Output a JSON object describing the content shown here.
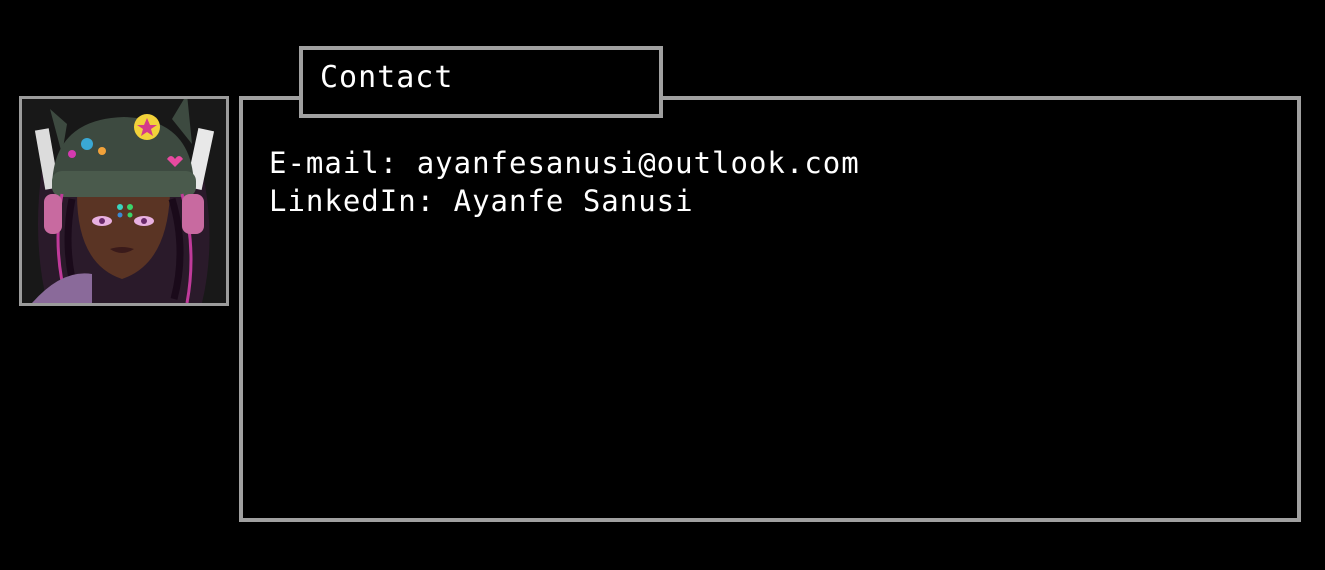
{
  "dialog": {
    "title": "Contact",
    "lines": [
      {
        "label": "E-mail:",
        "value": "ayanfesanusi@outlook.com"
      },
      {
        "label": "LinkedIn:",
        "value": "Ayanfe Sanusi"
      }
    ]
  },
  "portrait": {
    "icon": "character-portrait-icon"
  },
  "colors": {
    "background": "#000000",
    "border": "#a0a0a0",
    "text": "#ffffff"
  }
}
